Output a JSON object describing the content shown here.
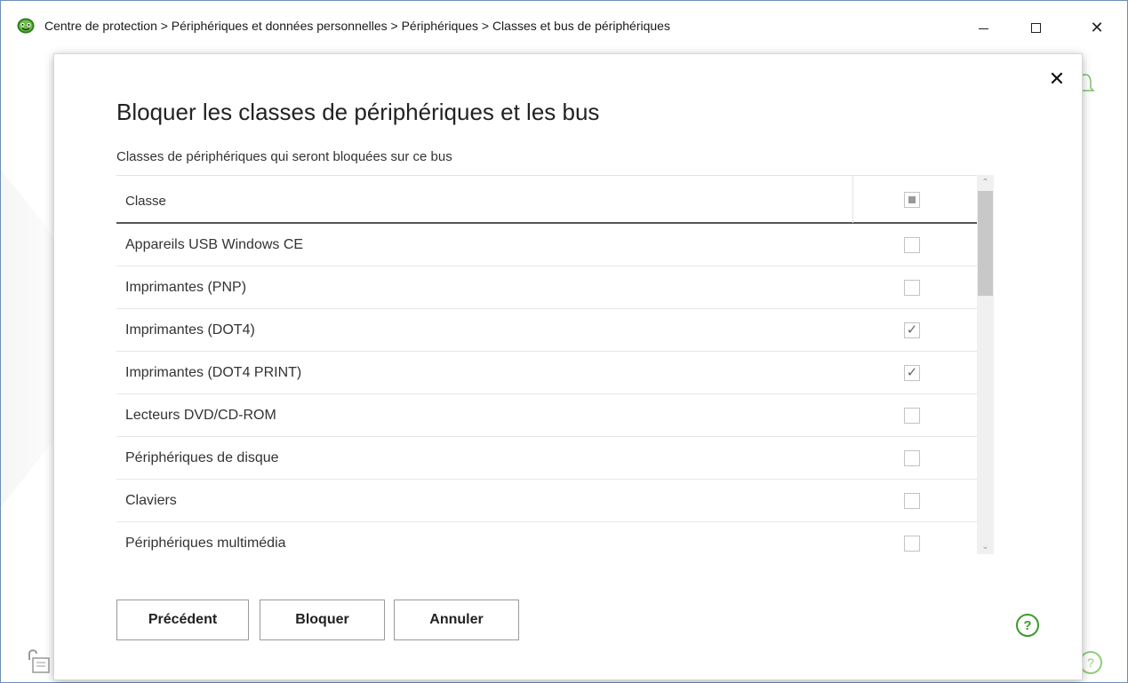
{
  "window": {
    "title": "Centre de protection > Périphériques et données personnelles > Périphériques > Classes et bus de périphériques",
    "icon": "app-logo-icon",
    "controls": {
      "minimize": "minimize-icon",
      "maximize": "maximize-icon",
      "close": "✕"
    }
  },
  "dialog": {
    "close_label": "✕",
    "title": "Bloquer les classes de périphériques et les bus",
    "subtitle": "Classes de périphériques qui seront bloquées sur ce bus",
    "table": {
      "header_class": "Classe",
      "header_select_all_state": "partial",
      "rows": [
        {
          "label": "Appareils USB Windows CE",
          "checked": false
        },
        {
          "label": "Imprimantes (PNP)",
          "checked": false
        },
        {
          "label": "Imprimantes (DOT4)",
          "checked": true
        },
        {
          "label": "Imprimantes (DOT4 PRINT)",
          "checked": true
        },
        {
          "label": "Lecteurs DVD/CD-ROM",
          "checked": false
        },
        {
          "label": "Périphériques de disque",
          "checked": false
        },
        {
          "label": "Claviers",
          "checked": false
        },
        {
          "label": "Périphériques multimédia",
          "checked": false
        }
      ]
    },
    "buttons": {
      "previous": "Précédent",
      "block": "Bloquer",
      "cancel": "Annuler"
    },
    "help_label": "?"
  },
  "colors": {
    "accent_green": "#3a9a2a",
    "window_border": "#6a8fb8"
  }
}
